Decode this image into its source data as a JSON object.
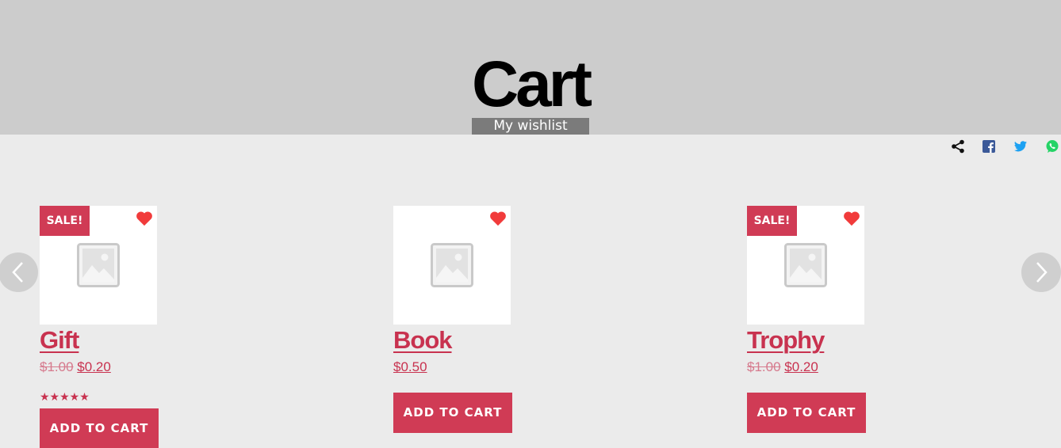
{
  "header": {
    "title": "Cart",
    "wishlist_label": "My wishlist"
  },
  "share": {
    "icons": [
      "share-icon",
      "facebook-icon",
      "twitter-icon",
      "whatsapp-icon"
    ],
    "colors": {
      "facebook": "#3b5998",
      "twitter": "#1da1f2",
      "whatsapp": "#25d366"
    }
  },
  "colors": {
    "accent": "#d03b55",
    "header_bg": "#cccccc",
    "page_bg": "#ebebeb",
    "heart": "#f13b3b"
  },
  "products": [
    {
      "title": "Gift",
      "sale_badge": "SALE!",
      "old_price": "$1.00",
      "price": "$0.20",
      "rating": 5,
      "stars": "★★★★★",
      "button": "ADD TO CART"
    },
    {
      "title": "Book",
      "sale_badge": "",
      "old_price": "",
      "price": "$0.50",
      "button": "ADD TO CART"
    },
    {
      "title": "Trophy",
      "sale_badge": "SALE!",
      "old_price": "$1.00",
      "price": "$0.20",
      "button": "ADD TO CART"
    }
  ],
  "carousel": {
    "prev_icon": "chevron-left-icon",
    "next_icon": "chevron-right-icon"
  }
}
